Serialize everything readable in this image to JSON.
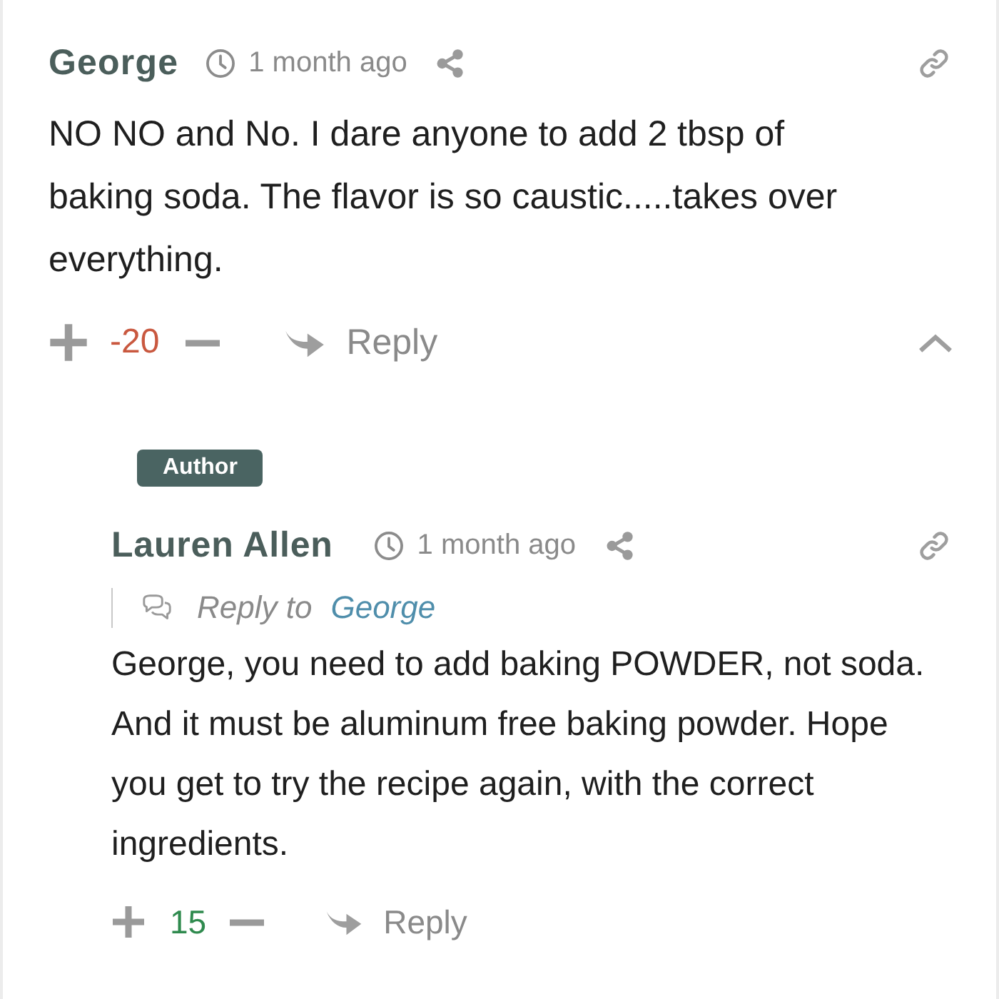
{
  "comments": [
    {
      "author": "George",
      "time": "1 month ago",
      "body": "NO NO and No. I dare anyone to add 2 tbsp of baking soda. The flavor is so caustic.....takes over everything.",
      "votes": {
        "count": "-20",
        "color": "#c9583f"
      },
      "reply_label": "Reply",
      "expanded": true,
      "children": [
        {
          "badge": "Author",
          "author": "Lauren Allen",
          "time": "1 month ago",
          "reply_to": {
            "label": "Reply to",
            "name": "George"
          },
          "body": "George, you need to add baking POWDER, not soda. And it must be aluminum free baking powder. Hope you get to try the recipe again, with the correct ingredients.",
          "votes": {
            "count": "15",
            "color": "#2f8a4e"
          },
          "reply_label": "Reply"
        }
      ]
    }
  ]
}
